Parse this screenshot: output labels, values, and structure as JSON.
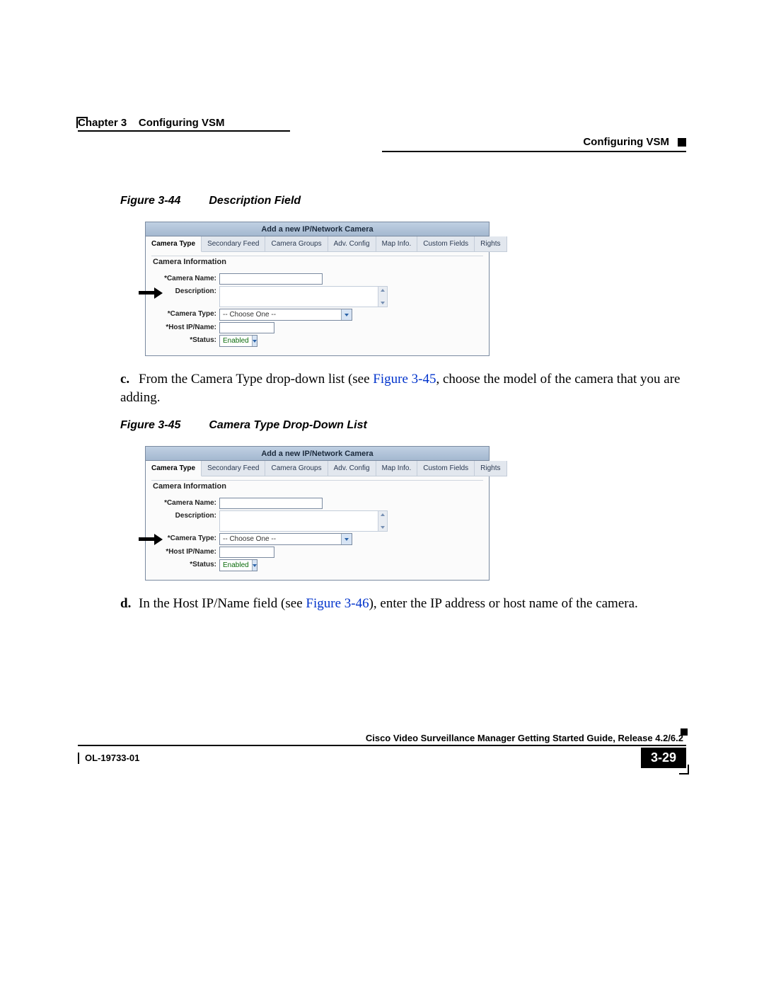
{
  "header": {
    "chapter_label": "Chapter 3",
    "chapter_title": "Configuring VSM",
    "section_title": "Configuring VSM"
  },
  "figures": {
    "fig44": {
      "num": "Figure 3-44",
      "title": "Description Field"
    },
    "fig45": {
      "num": "Figure 3-45",
      "title": "Camera Type Drop-Down List"
    }
  },
  "steps": {
    "c": {
      "marker": "c.",
      "pre": "From the Camera Type drop-down list (see ",
      "xref": "Figure 3-45",
      "post": ", choose the model of the camera that you are adding."
    },
    "d": {
      "marker": "d.",
      "pre": "In the Host IP/Name field (see ",
      "xref": "Figure 3-46",
      "post": "), enter the IP address or host name of the camera."
    }
  },
  "app": {
    "window_title": "Add a new IP/Network Camera",
    "tabs": [
      "Camera Type",
      "Secondary Feed",
      "Camera Groups",
      "Adv. Config",
      "Map Info.",
      "Custom Fields",
      "Rights"
    ],
    "fieldset": "Camera Information",
    "labels": {
      "camera_name": "*Camera Name:",
      "description": "Description:",
      "camera_type": "*Camera Type:",
      "host": "*Host IP/Name:",
      "status": "*Status:"
    },
    "values": {
      "camera_type_placeholder": "-- Choose One --",
      "status_value": "Enabled"
    }
  },
  "footer": {
    "guide_title": "Cisco Video Surveillance Manager Getting Started Guide, Release 4.2/6.2",
    "doc_id": "OL-19733-01",
    "page_num": "3-29"
  }
}
